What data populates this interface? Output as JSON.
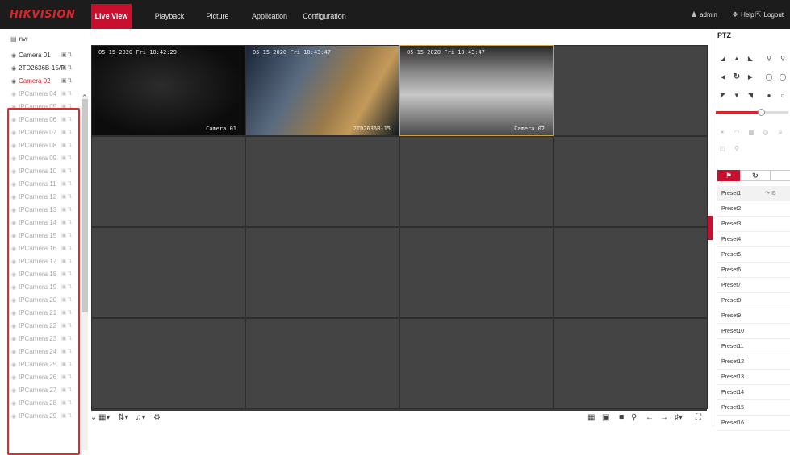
{
  "app": {
    "logo": "HIKVISION"
  },
  "nav": {
    "items": [
      "Live View",
      "Playback",
      "Picture",
      "Application",
      "Configuration"
    ]
  },
  "user": {
    "name": "admin",
    "help": "Help",
    "logout": "Logout"
  },
  "device_tree": {
    "root": "nvr",
    "cameras": [
      {
        "name": "Camera 01",
        "state": "online"
      },
      {
        "name": "2TD2636B-15/P",
        "state": "online"
      },
      {
        "name": "Camera 02",
        "state": "selected"
      },
      {
        "name": "IPCamera 04",
        "state": "offline"
      },
      {
        "name": "IPCamera 05",
        "state": "offline"
      },
      {
        "name": "IPCamera 06",
        "state": "offline"
      },
      {
        "name": "IPCamera 07",
        "state": "offline"
      },
      {
        "name": "IPCamera 08",
        "state": "offline"
      },
      {
        "name": "IPCamera 09",
        "state": "offline"
      },
      {
        "name": "IPCamera 10",
        "state": "offline"
      },
      {
        "name": "IPCamera 11",
        "state": "offline"
      },
      {
        "name": "IPCamera 12",
        "state": "offline"
      },
      {
        "name": "IPCamera 13",
        "state": "offline"
      },
      {
        "name": "IPCamera 14",
        "state": "offline"
      },
      {
        "name": "IPCamera 15",
        "state": "offline"
      },
      {
        "name": "IPCamera 16",
        "state": "offline"
      },
      {
        "name": "IPCamera 17",
        "state": "offline"
      },
      {
        "name": "IPCamera 18",
        "state": "offline"
      },
      {
        "name": "IPCamera 19",
        "state": "offline"
      },
      {
        "name": "IPCamera 20",
        "state": "offline"
      },
      {
        "name": "IPCamera 21",
        "state": "offline"
      },
      {
        "name": "IPCamera 22",
        "state": "offline"
      },
      {
        "name": "IPCamera 23",
        "state": "offline"
      },
      {
        "name": "IPCamera 24",
        "state": "offline"
      },
      {
        "name": "IPCamera 25",
        "state": "offline"
      },
      {
        "name": "IPCamera 26",
        "state": "offline"
      },
      {
        "name": "IPCamera 27",
        "state": "offline"
      },
      {
        "name": "IPCamera 28",
        "state": "offline"
      },
      {
        "name": "IPCamera 29",
        "state": "offline"
      }
    ]
  },
  "live": {
    "tiles": [
      {
        "timestamp": "05-15-2020 Fri 10:42:29",
        "name": "Camera 01"
      },
      {
        "timestamp": "05-15-2020 Fri 10:43:47",
        "name": "2TD2636B-15"
      },
      {
        "timestamp": "05-15-2020 Fri 10:43:47",
        "name": "Camera 02"
      }
    ]
  },
  "ptz": {
    "title": "PTZ",
    "presets": [
      "Preset1",
      "Preset2",
      "Preset3",
      "Preset4",
      "Preset5",
      "Preset6",
      "Preset7",
      "Preset8",
      "Preset9",
      "Preset10",
      "Preset11",
      "Preset12",
      "Preset13",
      "Preset14",
      "Preset15",
      "Preset16"
    ]
  },
  "colors": {
    "accent": "#c8102e",
    "topbar": "#1c1c1c",
    "highlight": "#e12b2b",
    "selected_tile": "#c9a34a"
  }
}
